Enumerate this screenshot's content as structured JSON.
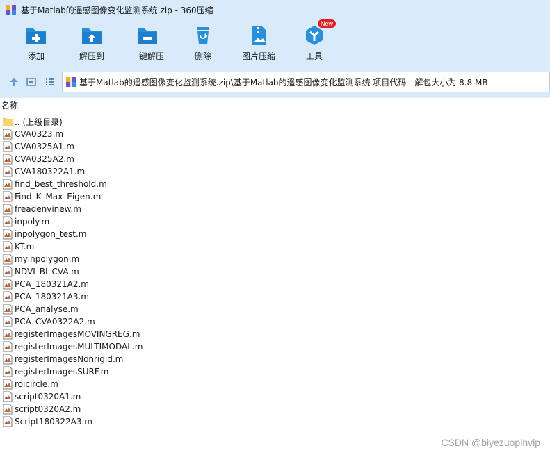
{
  "window": {
    "title": "基于Matlab的遥感图像变化监测系统.zip - 360压缩"
  },
  "toolbar": {
    "buttons": [
      {
        "label": "添加",
        "icon": "add-icon"
      },
      {
        "label": "解压到",
        "icon": "extract-to-icon"
      },
      {
        "label": "一键解压",
        "icon": "one-click-extract-icon"
      },
      {
        "label": "删除",
        "icon": "delete-icon"
      },
      {
        "label": "图片压缩",
        "icon": "image-compress-icon"
      },
      {
        "label": "工具",
        "icon": "tools-icon",
        "badge": "New"
      }
    ]
  },
  "address": {
    "path": "基于Matlab的遥感图像变化监测系统.zip\\基于Matlab的遥感图像变化监测系统 项目代码 - 解包大小为 8.8 MB"
  },
  "list": {
    "column_name": "名称",
    "parent": ".. (上级目录)",
    "files": [
      "CVA0323.m",
      "CVA0325A1.m",
      "CVA0325A2.m",
      "CVA180322A1.m",
      "find_best_threshold.m",
      "Find_K_Max_Eigen.m",
      "freadenvinew.m",
      "inpoly.m",
      "inpolygon_test.m",
      "KT.m",
      "myinpolygon.m",
      "NDVI_BI_CVA.m",
      "PCA_180321A2.m",
      "PCA_180321A3.m",
      "PCA_analyse.m",
      "PCA_CVA0322A2.m",
      "registerImagesMOVINGREG.m",
      "registerImagesMULTIMODAL.m",
      "registerImagesNonrigid.m",
      "registerImagesSURF.m",
      "roicircle.m",
      "script0320A1.m",
      "script0320A2.m",
      "Script180322A3.m"
    ]
  },
  "watermark": "CSDN @biyezuopinvip",
  "colors": {
    "accent": "#2a8fd8",
    "toolbar_bg": "#d9ebfa",
    "badge": "#e02020"
  }
}
